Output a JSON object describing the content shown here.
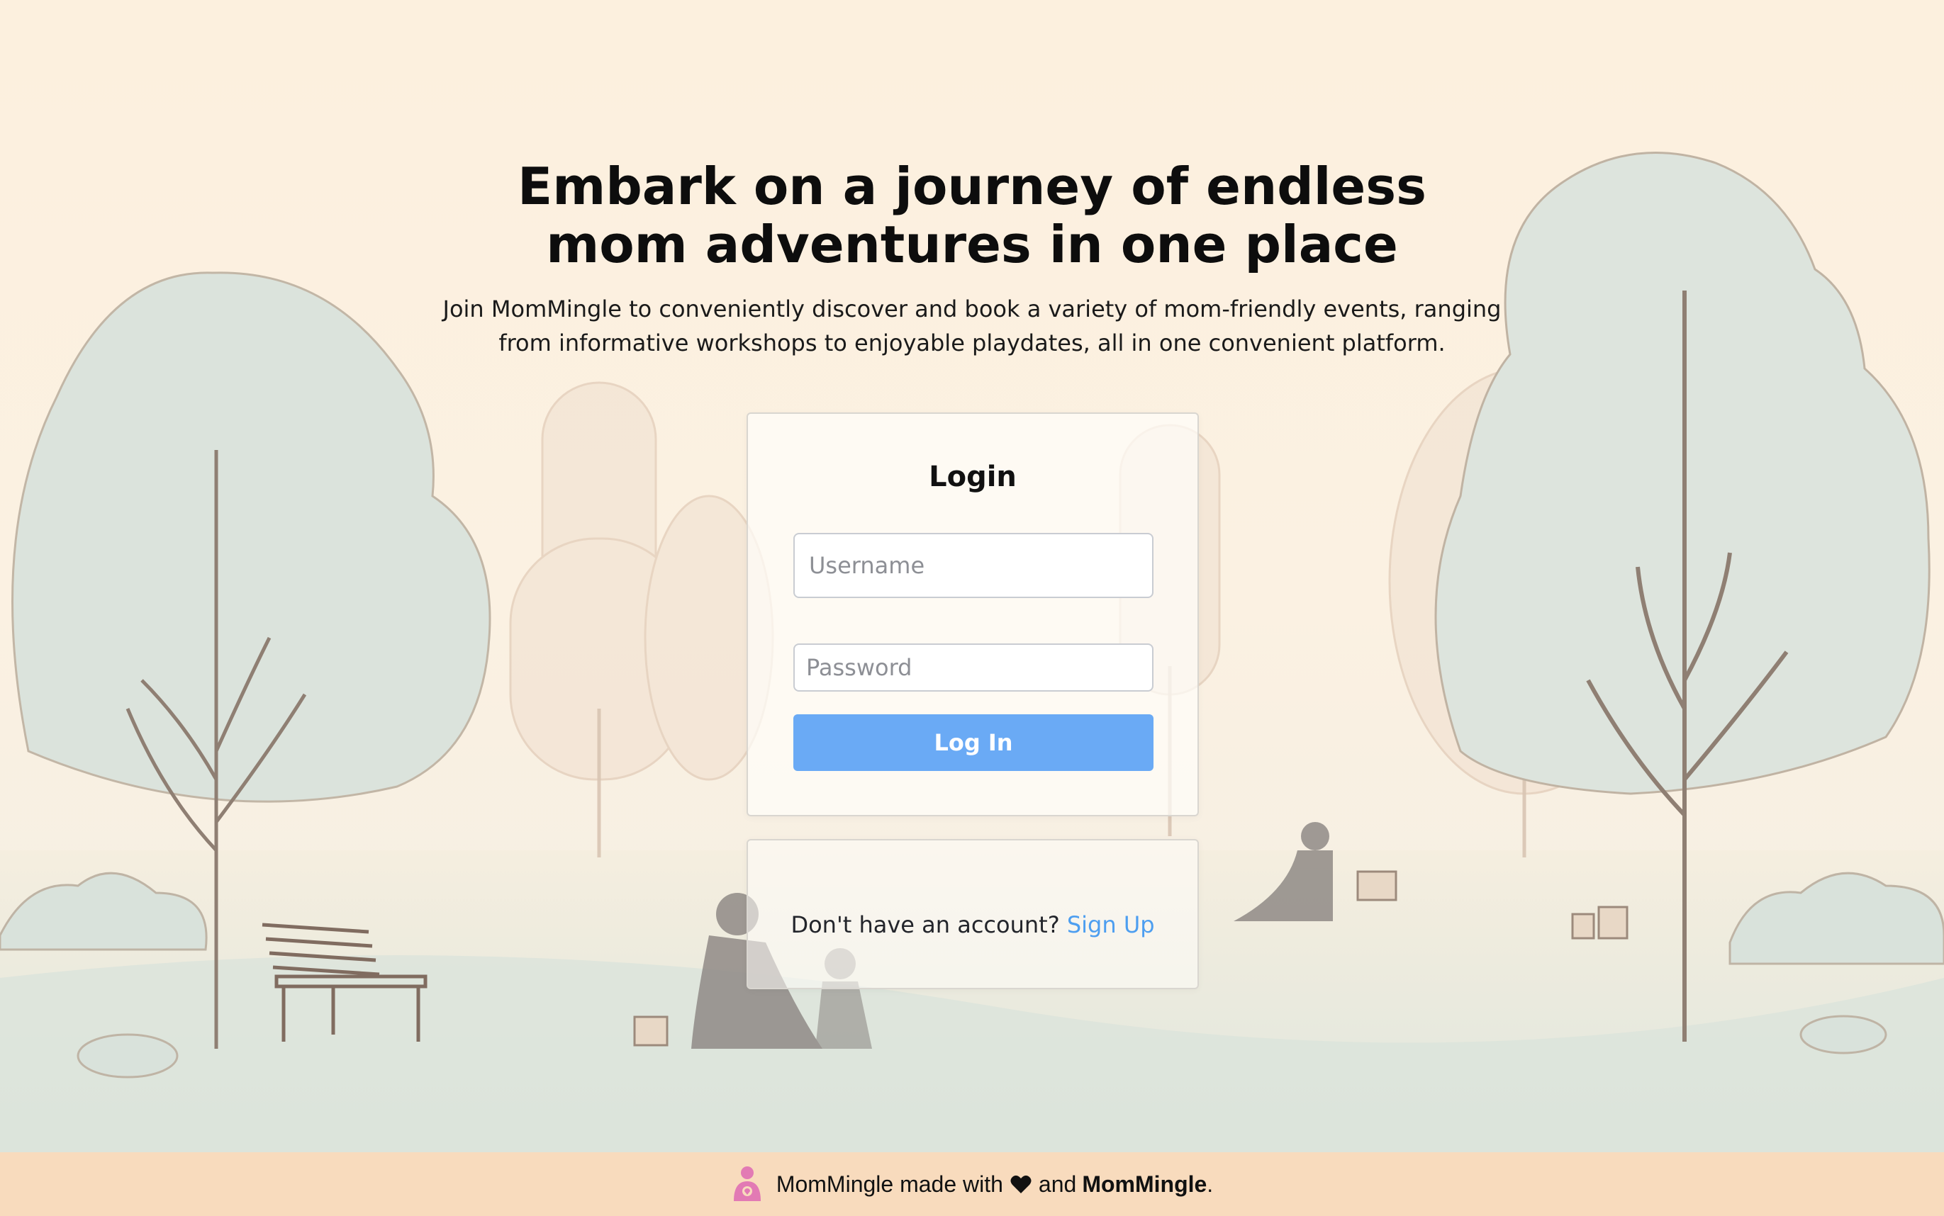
{
  "hero": {
    "title": "Embark on a journey of endless mom adventures in one place",
    "description": "Join MomMingle to conveniently discover and book a variety of mom-friendly events, ranging from informative workshops to enjoyable playdates, all in one convenient platform."
  },
  "login": {
    "title": "Login",
    "username_placeholder": "Username",
    "password_placeholder": "Password",
    "button_label": "Log In"
  },
  "signup": {
    "prompt": "Don't have an account?",
    "link_label": "Sign Up"
  },
  "footer": {
    "text_before": "MomMingle made with",
    "text_and": "and",
    "brand": "MomMingle",
    "period": ".",
    "background_color": "#f8dbbd"
  },
  "colors": {
    "accent": "#6aaaf5",
    "link": "#4d9ef0"
  },
  "icons": {
    "footer_logo": "mom-logo-icon",
    "heart": "heart-icon"
  }
}
